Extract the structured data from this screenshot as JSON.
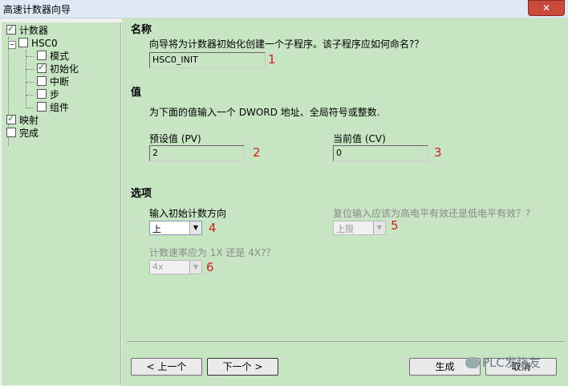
{
  "window": {
    "title": "高速计数器向导",
    "close_label": "✕"
  },
  "tree": {
    "items": [
      {
        "label": "计数器",
        "checked": true
      },
      {
        "label": "HSC0",
        "checked": false,
        "expander": "−"
      },
      {
        "label": "模式",
        "checked": false
      },
      {
        "label": "初始化",
        "checked": true
      },
      {
        "label": "中断",
        "checked": false
      },
      {
        "label": "步",
        "checked": false
      },
      {
        "label": "组件",
        "checked": false
      },
      {
        "label": "映射",
        "checked": true
      },
      {
        "label": "完成",
        "checked": false
      }
    ]
  },
  "name_section": {
    "title": "名称",
    "prompt": "向导将为计数器初始化创建一个子程序。该子程序应如何命名?？",
    "value": "HSC0_INIT",
    "marker": "1"
  },
  "value_section": {
    "title": "值",
    "prompt": "为下面的值输入一个 DWORD 地址、全局符号或整数.",
    "preset_label": "预设值 (PV)",
    "preset_value": "2",
    "preset_marker": "2",
    "current_label": "当前值 (CV)",
    "current_value": "0",
    "current_marker": "3"
  },
  "options_section": {
    "title": "选项",
    "direction_label": "输入初始计数方向",
    "direction_value": "上",
    "direction_marker": "4",
    "reset_label": "复位输入应该为高电平有效还是低电平有效？?",
    "reset_value": "上限",
    "reset_marker": "5",
    "rate_label": "计数速率应为 1X 还是 4X?？",
    "rate_value": "4x",
    "rate_marker": "6"
  },
  "buttons": {
    "prev": "< 上一个",
    "next": "下一个 >",
    "finish": "生成",
    "cancel": "取消"
  },
  "watermark": "PLC发烧友"
}
